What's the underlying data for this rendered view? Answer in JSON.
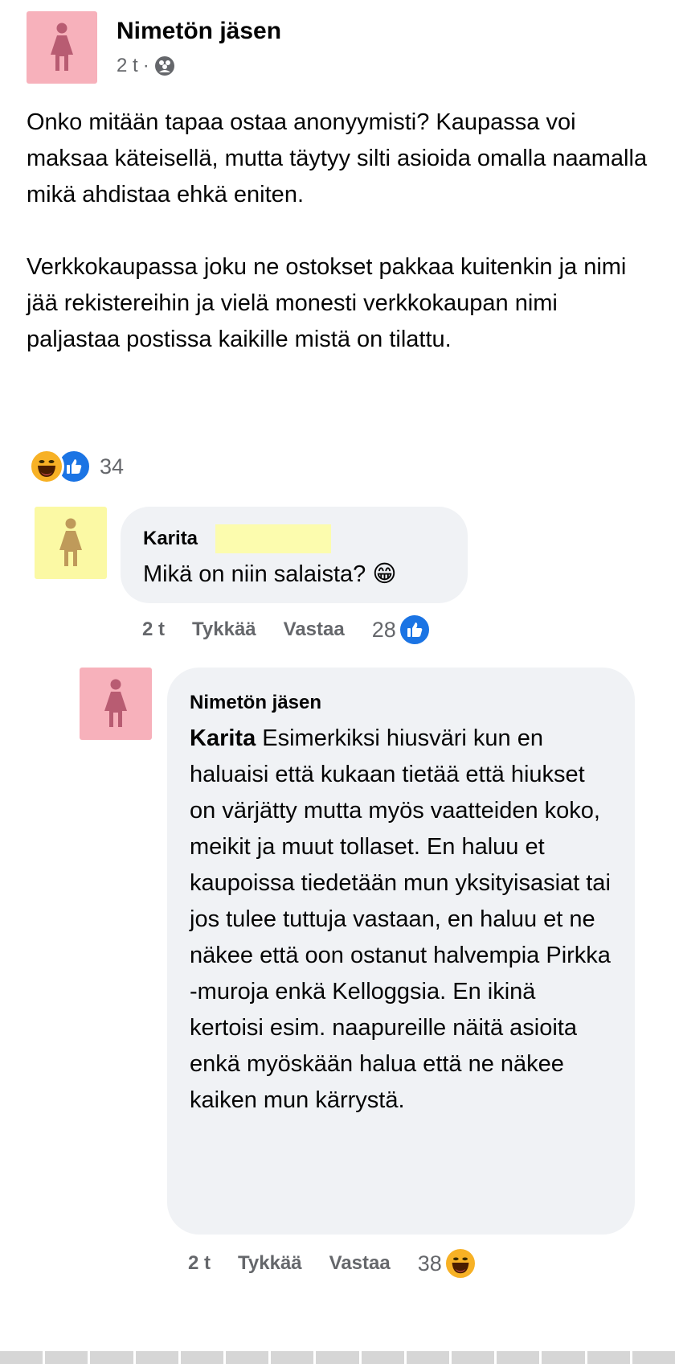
{
  "post": {
    "author": "Nimetön jäsen",
    "time": "2 t",
    "separator": "·",
    "audience_icon": "group-icon",
    "body": [
      "Onko mitään tapaa ostaa anonyymisti? Kaupassa voi maksaa käteisellä, mutta täytyy silti asioida omalla naamalla mikä ahdistaa ehkä eniten.",
      "Verkkokaupassa joku ne ostokset pakkaa kuitenkin ja nimi jää rekistereihin ja vielä monesti verkkokaupan nimi paljastaa postissa kaikille mistä on tilattu."
    ],
    "reactions": {
      "icons": [
        "haha-icon",
        "like-icon"
      ],
      "count": "34"
    }
  },
  "comments": [
    {
      "author": "Karita",
      "text": "Mikä on niin salaista? 😁",
      "time": "2 t",
      "like_label": "Tykkää",
      "reply_label": "Vastaa",
      "reaction_count": "28",
      "reaction_icon": "like-icon"
    },
    {
      "author": "Nimetön jäsen",
      "mention": "Karita",
      "text": " Esimerkiksi hiusväri kun en haluaisi että kukaan tietää että hiukset on värjätty mutta myös vaatteiden koko, meikit ja muut tollaset. En haluu et kaupoissa tiedetään mun yksityisasiat tai jos tulee tuttuja vastaan, en haluu et ne näkee että oon ostanut halvempia Pirkka -muroja enkä Kelloggsia. En ikinä kertoisi esim. naapureille näitä asioita enkä myöskään halua että ne näkee kaiken mun kärrystä.",
      "time": "2 t",
      "like_label": "Tykkää",
      "reply_label": "Vastaa",
      "reaction_count": "38",
      "reaction_icon": "haha-icon"
    }
  ],
  "colors": {
    "avatar_pink": "#f7b1bb",
    "avatar_yellow": "#fbf9a4",
    "avatar_figure_pink": "#b85c72",
    "avatar_figure_yellow": "#bf9a5a",
    "like_blue": "#1b74e4",
    "haha_yellow": "#f7b125"
  }
}
